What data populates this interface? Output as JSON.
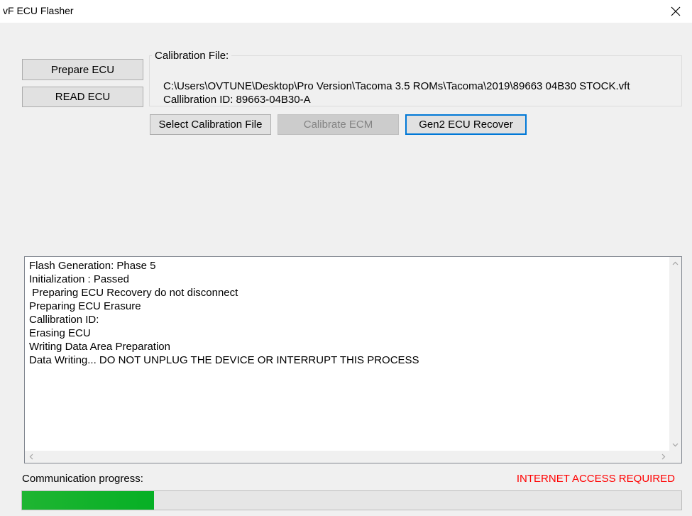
{
  "window": {
    "title": "vF ECU Flasher",
    "close_icon": "close-icon"
  },
  "buttons": {
    "prepare_ecu": "Prepare ECU",
    "read_ecu": "READ ECU",
    "select_calibration_file": "Select Calibration File",
    "calibrate_ecm": "Calibrate ECM",
    "gen2_ecu_recover": "Gen2 ECU Recover"
  },
  "calibration": {
    "group_label": "Calibration File:",
    "file_path": "C:\\Users\\OVTUNE\\Desktop\\Pro Version\\Tacoma 3.5 ROMs\\Tacoma\\2019\\89663 04B30 STOCK.vft",
    "calibration_id": "Callibration ID: 89663-04B30-A"
  },
  "log": {
    "lines": [
      "Flash Generation: Phase 5",
      "Initialization : Passed",
      " Preparing ECU Recovery do not disconnect",
      "Preparing ECU Erasure",
      "Callibration ID:",
      "Erasing ECU",
      "Writing Data Area Preparation",
      "Data Writing... DO NOT UNPLUG THE DEVICE OR INTERRUPT THIS PROCESS"
    ]
  },
  "status": {
    "communication_label": "Communication progress:",
    "internet_notice": "INTERNET ACCESS REQUIRED",
    "internet_notice_color": "#ff0000",
    "progress_fraction": 0.2,
    "progress_color": "#06b025"
  }
}
